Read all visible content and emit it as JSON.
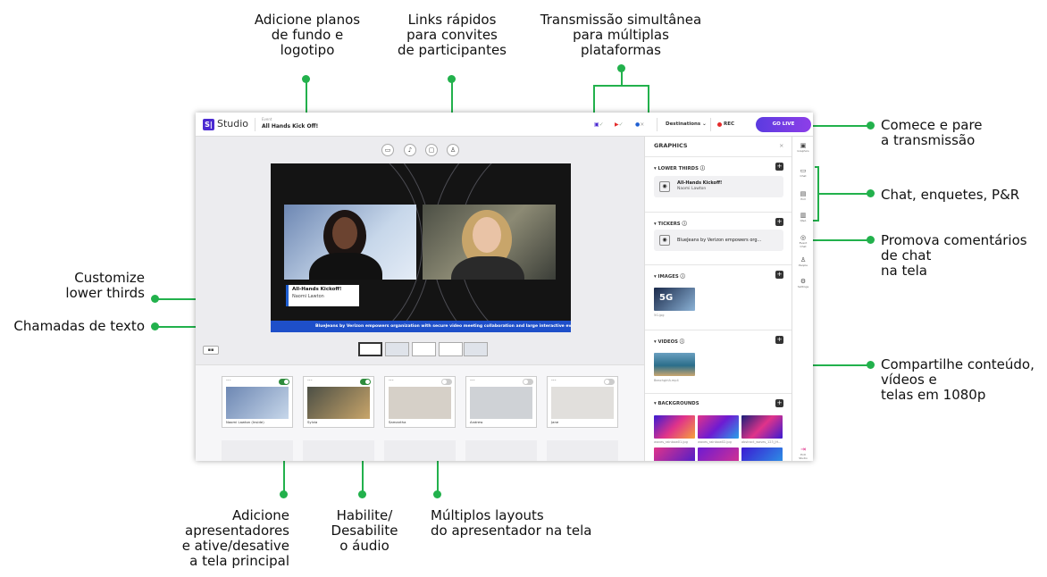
{
  "callouts": {
    "backgrounds": "Adicione planos\nde fundo e\nlogotipo",
    "quick_links": "Links rápidos\npara convites\nde participantes",
    "simulcast": "Transmissão simultânea\npara múltiplas\nplataformas",
    "start_stop": "Comece e pare\na transmissão",
    "chat_polls": "Chat, enquetes, P&R",
    "promote_chat": "Promova comentários\nde chat\nna tela",
    "lower_thirds": "Customize\nlower thirds",
    "text_callouts": "Chamadas de texto",
    "share_content": "Compartilhe conteúdo,\nvídeos e\ntelas em 1080p",
    "add_presenters": "Adicione\napresentadores\ne ative/desative\na tela principal",
    "audio": "Habilite/\nDesabilite\no áudio",
    "layouts": "Múltiplos layouts\ndo apresentador na tela"
  },
  "app": {
    "brand": "Studio",
    "logo_letters": "S|",
    "event_label": "Event",
    "event_name": "All Hands Kick Off!",
    "destinations": "Destinations ⌄",
    "rec": "REC",
    "go_live": "GO LIVE",
    "colors": {
      "accent": "#6a3de4",
      "green": "#22b14c",
      "ticker": "#1e4fc9",
      "rec": "#e42b2b"
    }
  },
  "stage": {
    "lower_third_title": "All-Hands Kickoff!",
    "lower_third_name": "Naomi Lawton",
    "ticker_text": "BlueJeans by Verizon empowers organization with secure video meeting collaboration and large interactive events fro"
  },
  "panel": {
    "title": "GRAPHICS",
    "close": "×",
    "lower_thirds": "LOWER THIRDS",
    "lt_card_title": "All-Hands Kickoff!",
    "lt_card_sub": "Naomi Lawton",
    "tickers": "TICKERS",
    "ticker_card": "BlueJeans by Verizon empowers org...",
    "images": "IMAGES",
    "image_cap": "5G.jpg",
    "image_text": "5G",
    "videos": "VIDEOS",
    "video_cap": "BeachgirlA.mp4",
    "backgrounds": "BACKGROUNDS",
    "bg_caps": [
      "waves_rainbow01.jpg",
      "waves_rainbow02.jpg",
      "abstract_waves_123_JH..."
    ]
  },
  "rail": [
    {
      "label": "Graphics",
      "icon": "▣"
    },
    {
      "label": "Chat",
      "icon": "▭"
    },
    {
      "label": "Poll",
      "icon": "▤"
    },
    {
      "label": "Q&A",
      "icon": "▥"
    },
    {
      "label": "Event Chat",
      "icon": "◎"
    },
    {
      "label": "People",
      "icon": "♙"
    },
    {
      "label": "Settings",
      "icon": "⚙"
    },
    {
      "label": "Exit Studio",
      "icon": "⇥"
    }
  ],
  "presenters": [
    {
      "name": "Naomi Lawton (Inside)",
      "on": true
    },
    {
      "name": "Sylvia",
      "on": true
    },
    {
      "name": "Samantha",
      "on": false
    },
    {
      "name": "Andrew",
      "on": false
    },
    {
      "name": "Jane",
      "on": false
    }
  ]
}
